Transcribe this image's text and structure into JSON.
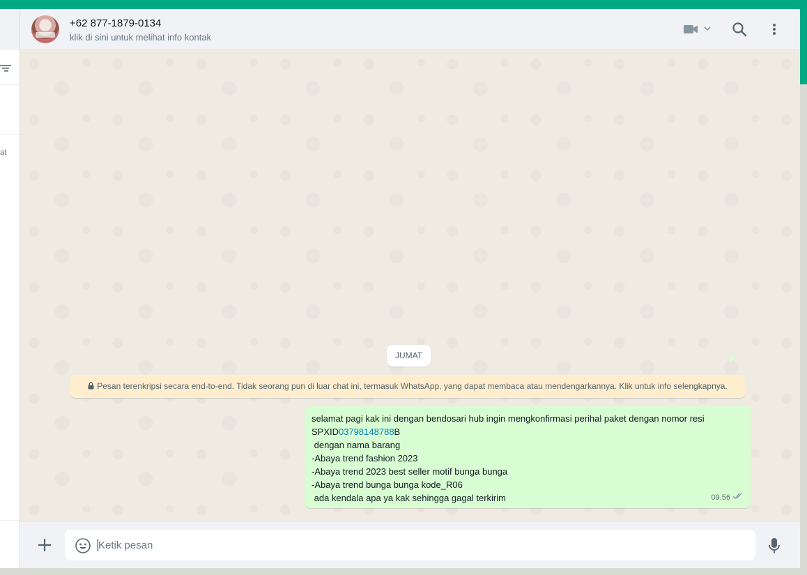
{
  "sidebar": {
    "fragment_text": "at"
  },
  "header": {
    "contact_name": "+62 877-1879-0134",
    "contact_subtitle": "klik di sini untuk melihat info kontak",
    "icons": [
      "video-call-icon",
      "chevron-down-icon",
      "search-icon",
      "menu-icon"
    ]
  },
  "chat": {
    "date_label": "JUMAT",
    "encryption_notice": "Pesan terenkripsi secara end-to-end. Tidak seorang pun di luar chat ini, termasuk WhatsApp, yang dapat membaca atau mendengarkannya. Klik untuk info selengkapnya.",
    "message": {
      "line1": "selamat pagi kak ini dengan bendosari hub ingin mengkonfirmasi perihal paket dengan nomor resi",
      "resi_prefix": "SPXID",
      "resi_link": "03798148788",
      "resi_suffix": "B",
      "line3": " dengan nama barang",
      "line4": "-Abaya trend fashion 2023",
      "line5": "-Abaya trend 2023 best seller motif bunga bunga",
      "line6": "-Abaya trend bunga bunga kode_R06",
      "line7": " ada kendala apa ya kak sehingga gagal terkirim",
      "time": "09.56",
      "status": "read"
    }
  },
  "footer": {
    "input_placeholder": "Ketik pesan",
    "input_value": ""
  },
  "colors": {
    "accent": "#00a884",
    "outgoing_bubble": "#d9fdd3",
    "chat_background": "#efeae2",
    "notice_background": "#ffeecd",
    "link": "#027eb5",
    "read_ticks": "#667781"
  }
}
